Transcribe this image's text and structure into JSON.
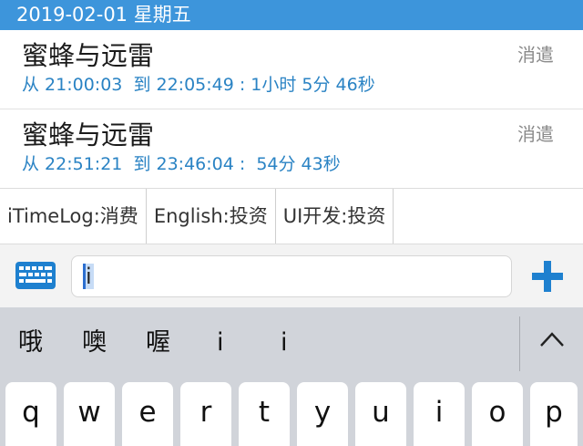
{
  "date_header": "2019-02-01 星期五",
  "entries": [
    {
      "title": "蜜蜂与远雷",
      "category": "消遣",
      "range": "从 21:00:03  到 22:05:49 : 1小时 5分 46秒"
    },
    {
      "title": "蜜蜂与远雷",
      "category": "消遣",
      "range": "从 22:51:21  到 23:46:04 :  54分 43秒"
    }
  ],
  "tags": [
    "iTimeLog:消费",
    "English:投资",
    "UI开发:投资"
  ],
  "input": {
    "value": "i"
  },
  "candidates": [
    "哦",
    "噢",
    "喔",
    "i",
    "i"
  ],
  "keys": [
    "q",
    "w",
    "e",
    "r",
    "t",
    "y",
    "u",
    "i",
    "o",
    "p"
  ],
  "colors": {
    "header": "#3d95db",
    "accent": "#1e80cf",
    "range_text": "#2a83c4"
  }
}
